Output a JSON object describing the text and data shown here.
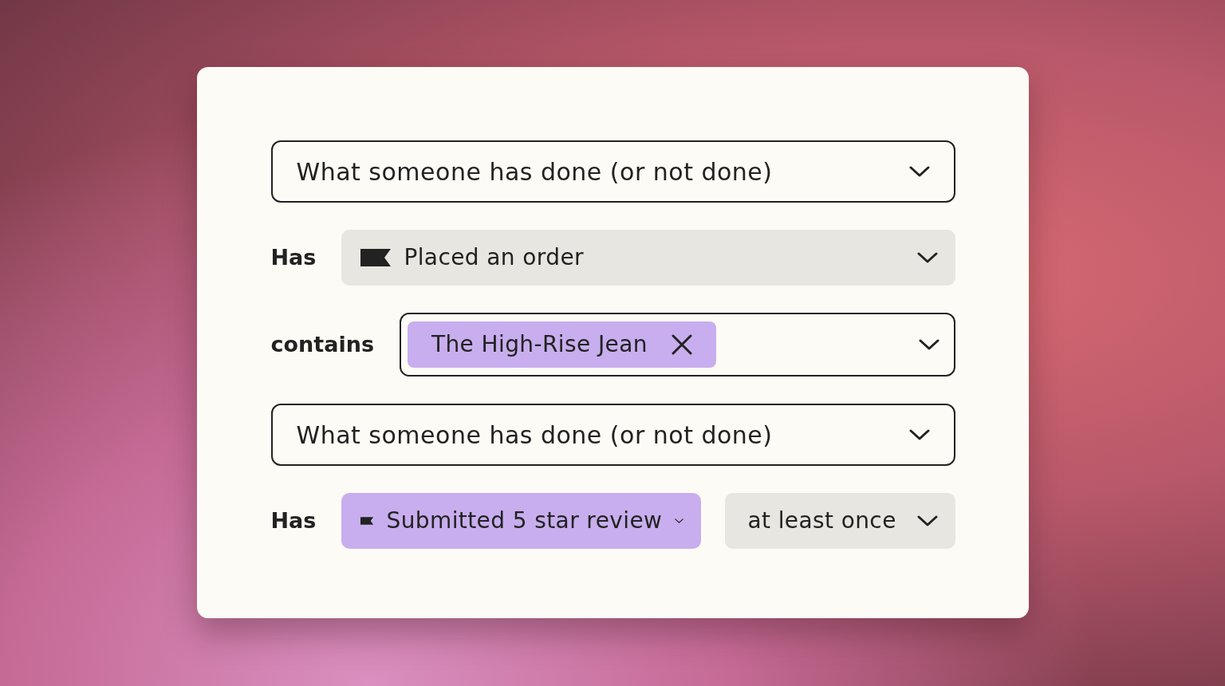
{
  "rows": [
    {
      "kind": "outlined",
      "value": "What someone has done (or not done)"
    },
    {
      "kind": "condition",
      "label": "Has",
      "selects": [
        {
          "kind": "event",
          "value": "Placed an order",
          "highlighted": false
        }
      ]
    },
    {
      "kind": "tags",
      "label": "contains",
      "tags": [
        {
          "text": "The High-Rise Jean"
        }
      ]
    },
    {
      "kind": "outlined",
      "value": "What someone has done (or not done)"
    },
    {
      "kind": "condition",
      "label": "Has",
      "selects": [
        {
          "kind": "event",
          "value": "Submitted 5 star review",
          "highlighted": true
        },
        {
          "kind": "frequency",
          "value": "at least once",
          "highlighted": false
        }
      ]
    }
  ]
}
